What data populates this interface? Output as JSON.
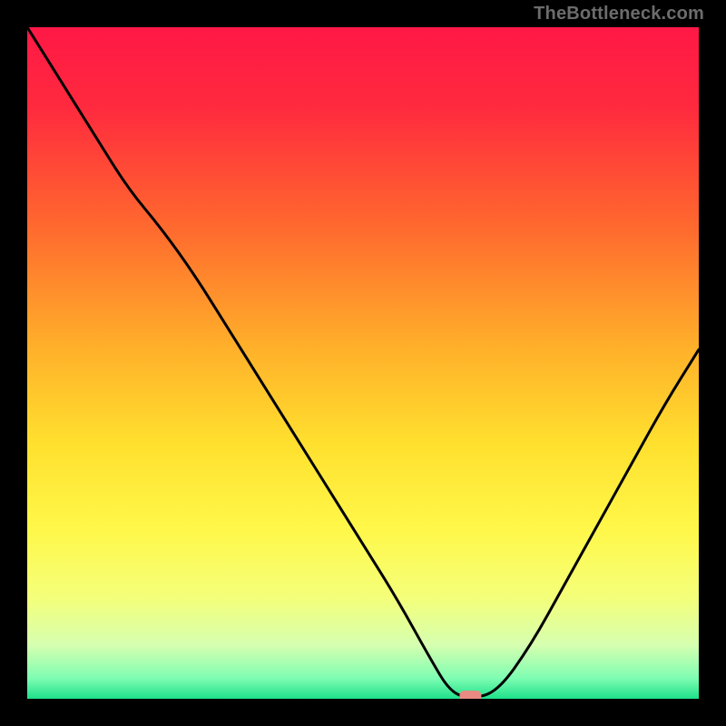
{
  "watermark": "TheBottleneck.com",
  "chart_data": {
    "type": "line",
    "title": "",
    "xlabel": "",
    "ylabel": "",
    "xlim": [
      0,
      100
    ],
    "ylim": [
      0,
      100
    ],
    "x": [
      0,
      5,
      10,
      15,
      20,
      25,
      30,
      35,
      40,
      45,
      50,
      55,
      60,
      63,
      66,
      70,
      75,
      80,
      85,
      90,
      95,
      100
    ],
    "values": [
      100,
      92,
      84,
      76,
      70,
      63,
      55,
      47,
      39,
      31,
      23,
      15,
      6,
      1,
      0,
      1,
      8,
      17,
      26,
      35,
      44,
      52
    ],
    "marker": {
      "x": 66,
      "y": 0
    },
    "gradient_stops": [
      {
        "offset": 0.0,
        "color": "#ff1846"
      },
      {
        "offset": 0.12,
        "color": "#ff2a3e"
      },
      {
        "offset": 0.3,
        "color": "#ff6a2e"
      },
      {
        "offset": 0.48,
        "color": "#ffb12a"
      },
      {
        "offset": 0.62,
        "color": "#ffe02e"
      },
      {
        "offset": 0.75,
        "color": "#fff84a"
      },
      {
        "offset": 0.85,
        "color": "#f4ff7a"
      },
      {
        "offset": 0.92,
        "color": "#d6ffb0"
      },
      {
        "offset": 0.97,
        "color": "#7dfdb2"
      },
      {
        "offset": 1.0,
        "color": "#1ee08a"
      }
    ]
  }
}
